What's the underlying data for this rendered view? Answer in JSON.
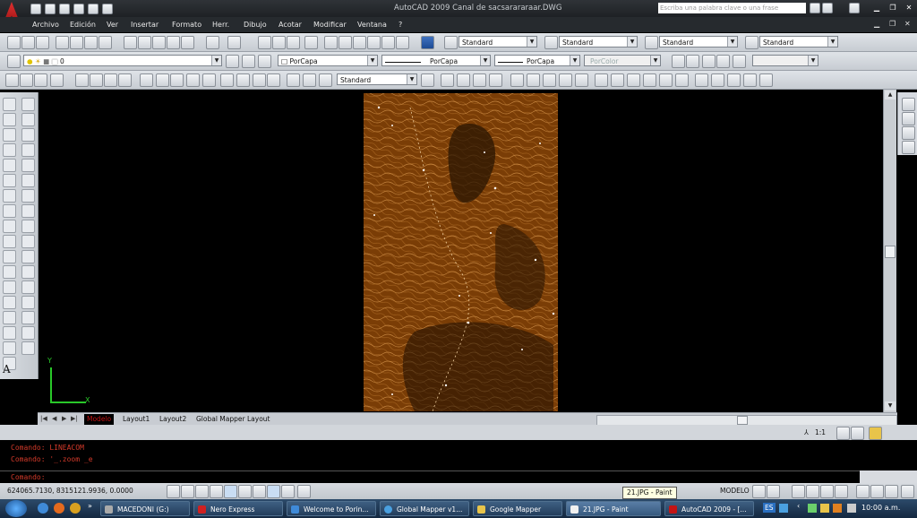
{
  "title_bar": {
    "title": "AutoCAD 2009  Canal de sacsarararaar.DWG",
    "search_placeholder": "Escriba una palabra clave o una frase"
  },
  "menu": [
    "Archivo",
    "Edición",
    "Ver",
    "Insertar",
    "Formato",
    "Herr.",
    "Dibujo",
    "Acotar",
    "Modificar",
    "Ventana",
    "?"
  ],
  "styles_toolbar": {
    "text_style": "Standard",
    "dim_style": "Standard",
    "table_style": "Standard",
    "mleader_style": "Standard"
  },
  "layers_toolbar": {
    "layer": "0",
    "color": "PorCapa",
    "linetype": "PorCapa",
    "lineweight": "PorCapa",
    "plotstyle": "PorColor"
  },
  "dim_toolbar": {
    "style": "Standard"
  },
  "colors": {
    "accent": "#c41414",
    "drawing_fill": "#7a3d06",
    "contour": "#e0a050",
    "ucs": "#29c829"
  },
  "ucs": {
    "x_label": "X",
    "y_label": "Y"
  },
  "layout_tabs": [
    {
      "label": "Modelo",
      "active": true
    },
    {
      "label": "Layout1",
      "active": false
    },
    {
      "label": "Layout2",
      "active": false
    },
    {
      "label": "Global Mapper Layout",
      "active": false
    }
  ],
  "annotation_scale": "1:1",
  "command_window": {
    "lines": [
      "Comando: LINEACOM",
      "Comando: '_.zoom _e"
    ],
    "prompt": "Comando:"
  },
  "status_bar": {
    "coordinates": "624065.7130, 8315121.9936, 0.0000",
    "model_label": "MODELO"
  },
  "taskbar": {
    "tasks": [
      "MACEDONI (G:)",
      "Nero Express",
      "Welcome to Porin...",
      "Global Mapper v1...",
      "Google Mapper",
      "21.JPG - Paint",
      "AutoCAD 2009 - [..."
    ],
    "lang": "ES",
    "time": "10:00 a.m.",
    "tooltip": "21.JPG - Paint"
  }
}
